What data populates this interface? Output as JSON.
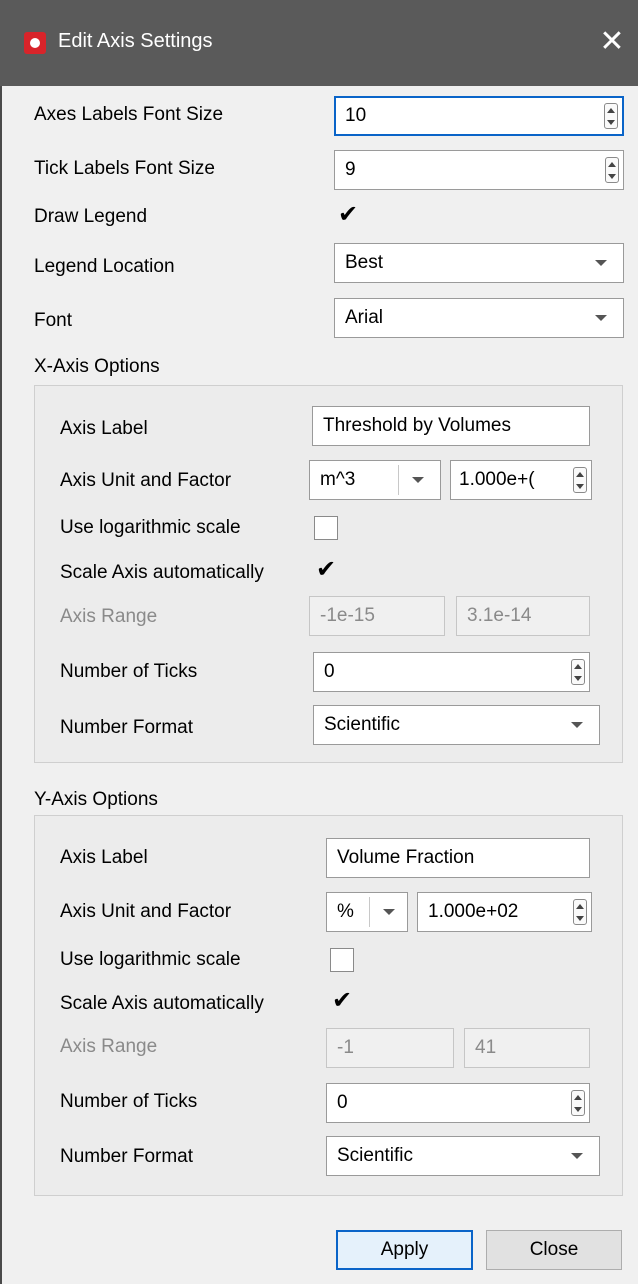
{
  "window": {
    "title": "Edit Axis Settings",
    "close_glyph": "✕",
    "icon": "app-logo-icon"
  },
  "general": {
    "axes_labels_font_size": {
      "label": "Axes Labels Font Size",
      "value": "10"
    },
    "tick_labels_font_size": {
      "label": "Tick Labels Font Size",
      "value": "9"
    },
    "draw_legend": {
      "label": "Draw Legend",
      "checked": true,
      "mark": "✔"
    },
    "legend_location": {
      "label": "Legend Location",
      "value": "Best"
    },
    "font": {
      "label": "Font",
      "value": "Arial"
    }
  },
  "x_axis": {
    "title": "X-Axis Options",
    "axis_label": {
      "label": "Axis Label",
      "value": "Threshold by Volumes"
    },
    "unit_factor": {
      "label": "Axis Unit and Factor",
      "unit": "m^3",
      "factor": "1.000e+("
    },
    "log_scale": {
      "label": "Use logarithmic scale",
      "checked": false
    },
    "auto_scale": {
      "label": "Scale Axis automatically",
      "checked": true,
      "mark": "✔"
    },
    "range": {
      "label": "Axis Range",
      "min": "-1e-15",
      "max": "3.1e-14"
    },
    "ticks": {
      "label": "Number of Ticks",
      "value": "0"
    },
    "format": {
      "label": "Number Format",
      "value": "Scientific"
    }
  },
  "y_axis": {
    "title": "Y-Axis Options",
    "axis_label": {
      "label": "Axis Label",
      "value": "Volume Fraction"
    },
    "unit_factor": {
      "label": "Axis Unit and Factor",
      "unit": "%",
      "factor": "1.000e+02"
    },
    "log_scale": {
      "label": "Use logarithmic scale",
      "checked": false
    },
    "auto_scale": {
      "label": "Scale Axis automatically",
      "checked": true,
      "mark": "✔"
    },
    "range": {
      "label": "Axis Range",
      "min": "-1",
      "max": "41"
    },
    "ticks": {
      "label": "Number of Ticks",
      "value": "0"
    },
    "format": {
      "label": "Number Format",
      "value": "Scientific"
    }
  },
  "buttons": {
    "apply": "Apply",
    "close": "Close"
  },
  "colors": {
    "titlebar": "#5a5a5a",
    "accent": "#0a64c8",
    "brand": "#d8242a"
  }
}
